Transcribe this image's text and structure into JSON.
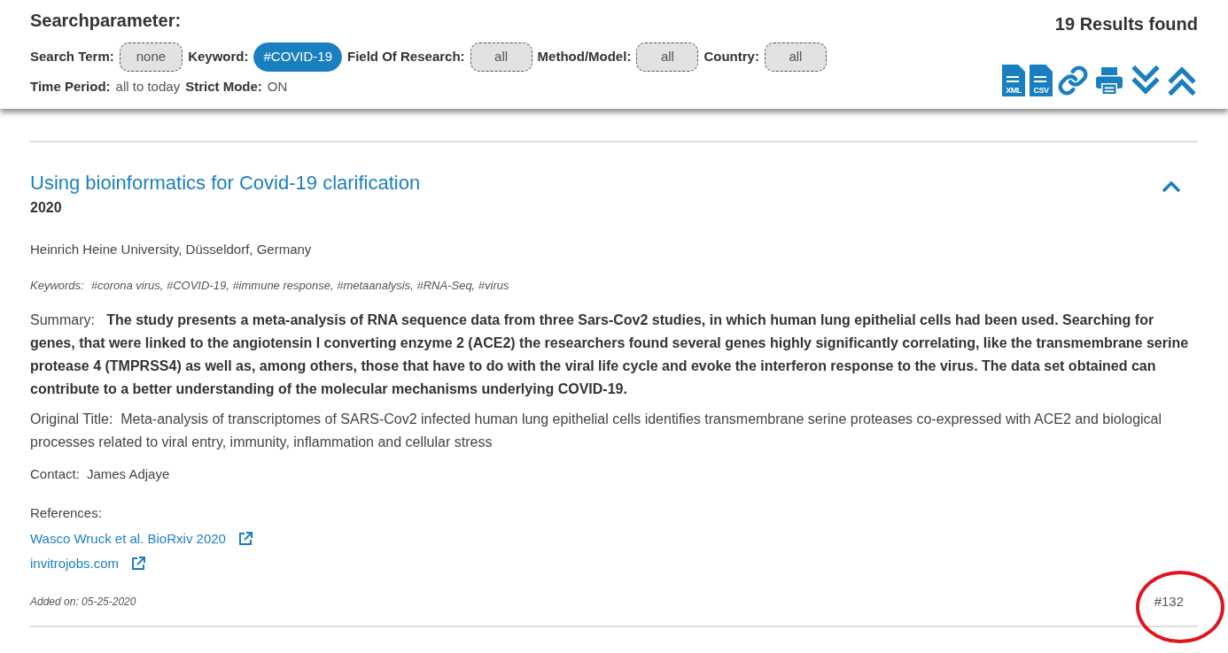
{
  "search_parameters": {
    "title": "Searchparameter:",
    "filters": [
      {
        "label": "Search Term:",
        "value": "none",
        "selected": false
      },
      {
        "label": "Keyword:",
        "value": "#COVID-19",
        "selected": true
      },
      {
        "label": "Field Of Research:",
        "value": "all",
        "selected": false
      },
      {
        "label": "Method/Model:",
        "value": "all",
        "selected": false
      },
      {
        "label": "Country:",
        "value": "all",
        "selected": false
      }
    ],
    "settings": [
      {
        "label": "Time Period:",
        "value": "all to today"
      },
      {
        "label": "Strict Mode:",
        "value": "ON"
      }
    ],
    "results_count": "19 Results found",
    "actions": [
      {
        "kind": "file",
        "label": "XML"
      },
      {
        "kind": "file",
        "label": "CSV"
      },
      {
        "kind": "link"
      },
      {
        "kind": "print"
      },
      {
        "kind": "expand-all"
      },
      {
        "kind": "collapse-all"
      }
    ]
  },
  "result": {
    "title": "Using bioinformatics for Covid-19 clarification",
    "expanded": true,
    "year": "2020",
    "institution": "Heinrich Heine University, Düsseldorf, Germany",
    "keywords_label": "Keywords:",
    "keywords": "#corona virus, #COVID-19, #immune response, #metaanalysis, #RNA-Seq, #virus",
    "summary": "Summary:   **The study presents a meta-analysis of RNA sequence data from three Sars-Cov2 studies, in which human lung epithelial cells had been used. Searching for genes, that were linked to the angiotensin I converting enzyme 2 (ACE2) the researchers found several genes highly significantly correlating, like the transmembrane serine protease 4 (TMPRSS4) as well as, among others, those that have to do with the viral life cycle and evoke the interferon response to the virus. The data set obtained can contribute to a better understanding of the molecular mechanisms underlying COVID-19.**",
    "original_title": "Original Title:  Meta-analysis of transcriptomes of SARS-Cov2 infected human lung epithelial cells identifies transmembrane serine proteases co-expressed with ACE2 and biological processes related to viral entry, immunity, inflammation and cellular stress",
    "contact_label": "Contact:",
    "contact": "James Adjaye",
    "references_label": "References:",
    "references": [
      {
        "text": "Wasco Wruck et al. BioRxiv 2020"
      },
      {
        "text": "invitrojobs.com"
      }
    ],
    "added_on": "Added on: 05-25-2020",
    "number": "#132"
  }
}
